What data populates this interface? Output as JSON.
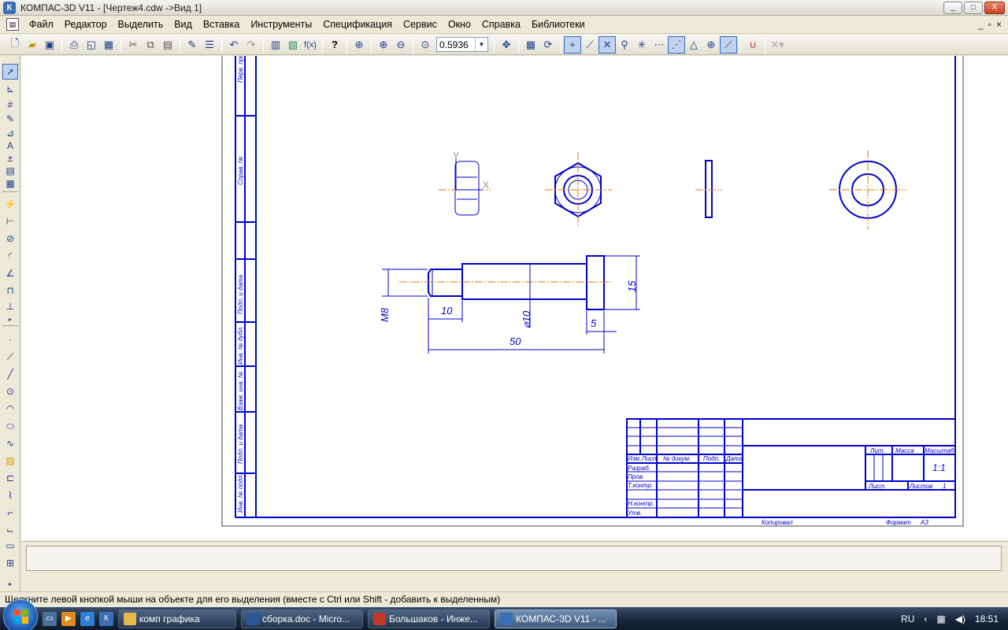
{
  "window": {
    "title": "КОМПАС-3D V11 - [Чертеж4.cdw ->Вид 1]",
    "app_icon": "К",
    "buttons": [
      "_",
      "□",
      "X"
    ]
  },
  "menu": {
    "items": [
      "Файл",
      "Редактор",
      "Выделить",
      "Вид",
      "Вставка",
      "Инструменты",
      "Спецификация",
      "Сервис",
      "Окно",
      "Справка",
      "Библиотеки"
    ],
    "mdi_buttons": [
      "_",
      "▫",
      "×"
    ]
  },
  "toolbar": {
    "zoom_value": "0.5936",
    "formula_label": "f(x)",
    "help_label": "?"
  },
  "drawing": {
    "stamp_labels": [
      "Перв. прим.",
      "Справ. №",
      "Подп. и дата",
      "Инв. № дубл.",
      "Взам. инв. №",
      "Подп. и дата",
      "Инв. № подл."
    ],
    "axis_x": "X",
    "axis_y": "Y",
    "dimensions": {
      "m8": "M8",
      "len10": "10",
      "dia10": "⌀10",
      "head15": "15",
      "head5": "5",
      "len50": "50"
    },
    "title_block": {
      "cols": [
        "Изм.",
        "Лист",
        "№ докум.",
        "Подп.",
        "Дата"
      ],
      "rows": [
        "Разраб.",
        "Пров.",
        "Т.контр.",
        "Н.контр.",
        "Утв."
      ],
      "lit": "Лит.",
      "mass": "Масса",
      "scale": "Масштаб",
      "scale_value": "1:1",
      "sheet": "Лист",
      "sheets": "Листов",
      "sheets_value": "1",
      "copied": "Копировал",
      "format_label": "Формат",
      "format_value": "А3"
    }
  },
  "status": {
    "text": "Щелкните левой кнопкой мыши на объекте для его выделения (вместе с Ctrl или Shift - добавить к выделенным)"
  },
  "taskbar": {
    "tasks": [
      {
        "label": "комп графика",
        "color": "#e6b84a"
      },
      {
        "label": "сборка.doc - Micro...",
        "color": "#2b5797"
      },
      {
        "label": "Большаков - Инже...",
        "color": "#c0392b"
      },
      {
        "label": "КОМПАС-3D V11 - ...",
        "color": "#3a6fb5"
      }
    ],
    "lang": "RU",
    "time": "18:51"
  }
}
